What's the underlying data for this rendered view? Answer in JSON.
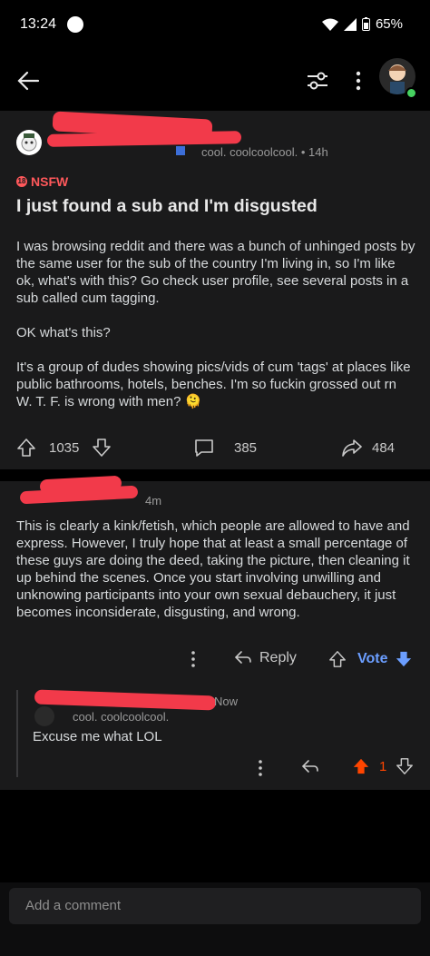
{
  "status_bar": {
    "time": "13:24",
    "battery": "65%"
  },
  "post": {
    "author_flair": "cool. coolcoolcool.",
    "age": "• 14h",
    "nsfw_label": "NSFW",
    "nsfw_badge": "18",
    "title": "I just found a sub and I'm disgusted",
    "body": [
      "I was browsing reddit and there was a bunch of unhinged posts by the same user for the sub of the country I'm living in, so I'm like ok, what's with this? Go check user profile, see several posts in a sub called cum tagging.",
      "OK what's this?",
      "It's a group of dudes showing pics/vids of cum 'tags' at places like public bathrooms, hotels, benches. I'm so fuckin grossed out rn W. T. F. is wrong with men? 🫠"
    ],
    "upvotes": "1035",
    "comments": "385",
    "shares": "484"
  },
  "comment": {
    "age": "4m",
    "body": "This is clearly a kink/fetish, which people are allowed to have and express. However, I truly hope that at least a small percentage of these guys are doing the deed, taking the picture, then cleaning it up behind the scenes. Once you start involving unwilling and unknowing participants into your own sexual debauchery, it just becomes inconsiderate, disgusting, and wrong.",
    "reply_label": "Reply",
    "vote_label": "Vote"
  },
  "reply": {
    "age": "Now",
    "author_flair": "cool. coolcoolcool.",
    "body": "Excuse me what LOL",
    "score": "1"
  },
  "composer": {
    "placeholder": "Add a comment"
  },
  "colors": {
    "accent_red": "#f23a4a",
    "nsfw": "#ff585b",
    "upvote_orange": "#ff4500",
    "vote_blue": "#6b9eff"
  }
}
